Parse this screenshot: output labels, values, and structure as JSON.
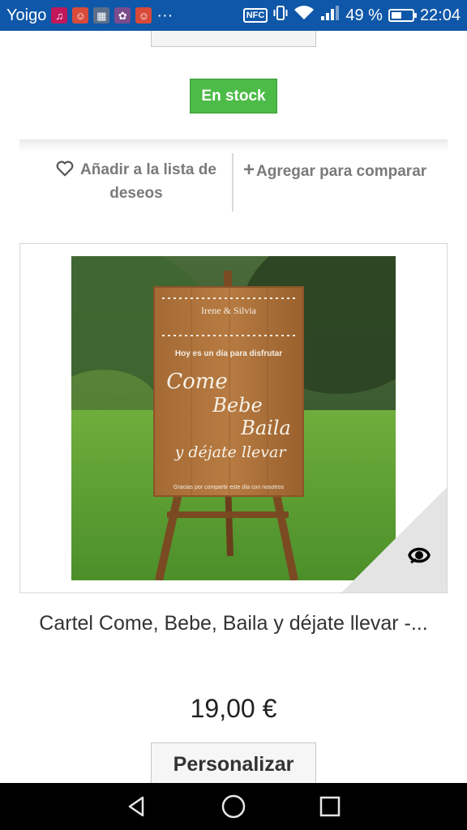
{
  "status_bar": {
    "carrier": "Yoigo",
    "overflow": "···",
    "nfc": "NFC",
    "battery_percent": "49 %",
    "battery_level": 0.49,
    "time": "22:04",
    "icons": [
      "music-note-icon",
      "app-notification-icon",
      "image-notification-icon",
      "photo-notification-icon",
      "app-notification-icon",
      "nfc-icon",
      "vibrate-icon",
      "wifi-icon",
      "signal-icon",
      "battery-icon"
    ]
  },
  "product": {
    "stock_label": "En stock",
    "wishlist_label": "Añadir a la lista de deseos",
    "compare_label": "Agregar para comparar",
    "title": "Cartel Come, Bebe, Baila y déjate llevar -...",
    "price": "19,00 €",
    "customize_label": "Personalizar"
  },
  "sign": {
    "names": "Irene & Silvia",
    "line1": "Hoy es un día para disfrutar",
    "come": "Come",
    "bebe": "Bebe",
    "baila": "Baila",
    "dejate": "y déjate llevar",
    "footer": "Gracias por compartir este día con nosotros"
  },
  "colors": {
    "status_bar": "#0f57a8",
    "stock_badge": "#4cbb47",
    "nav_bar": "#000000"
  },
  "nav": {
    "icons": [
      "back-icon",
      "home-icon",
      "recents-icon"
    ]
  }
}
